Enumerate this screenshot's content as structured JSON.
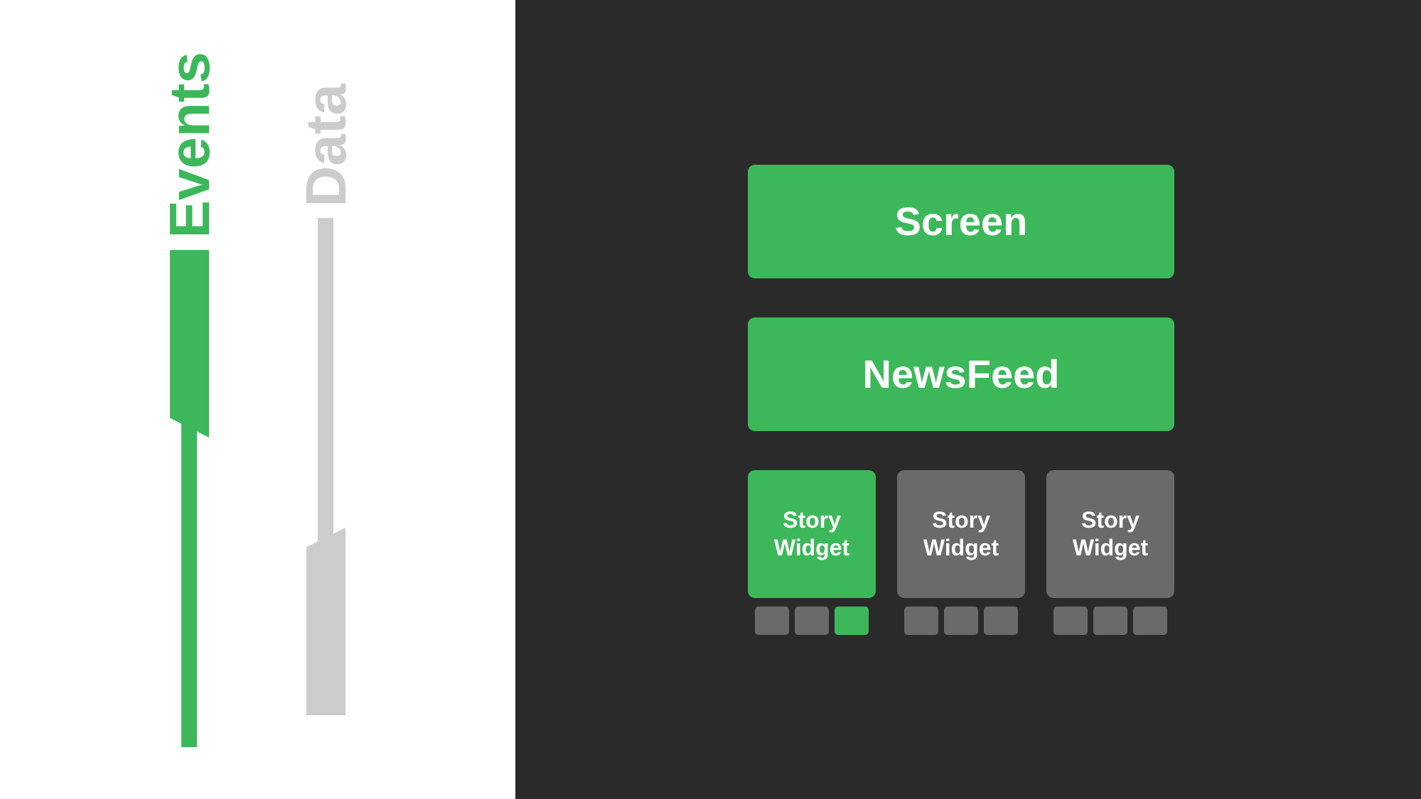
{
  "left_panel": {
    "events_label": "Events",
    "data_label": "Data",
    "events_color": "#3cb85a",
    "data_color": "#cccccc"
  },
  "right_panel": {
    "screen_label": "Screen",
    "newsfeed_label": "NewsFeed",
    "story_widgets": [
      {
        "label": "Story Widget",
        "color": "green",
        "dots": [
          "gray",
          "gray",
          "green"
        ]
      },
      {
        "label": "Story Widget",
        "color": "gray",
        "dots": [
          "gray",
          "gray",
          "gray"
        ]
      },
      {
        "label": "Story Widget",
        "color": "gray",
        "dots": [
          "gray",
          "gray",
          "gray"
        ]
      }
    ]
  }
}
